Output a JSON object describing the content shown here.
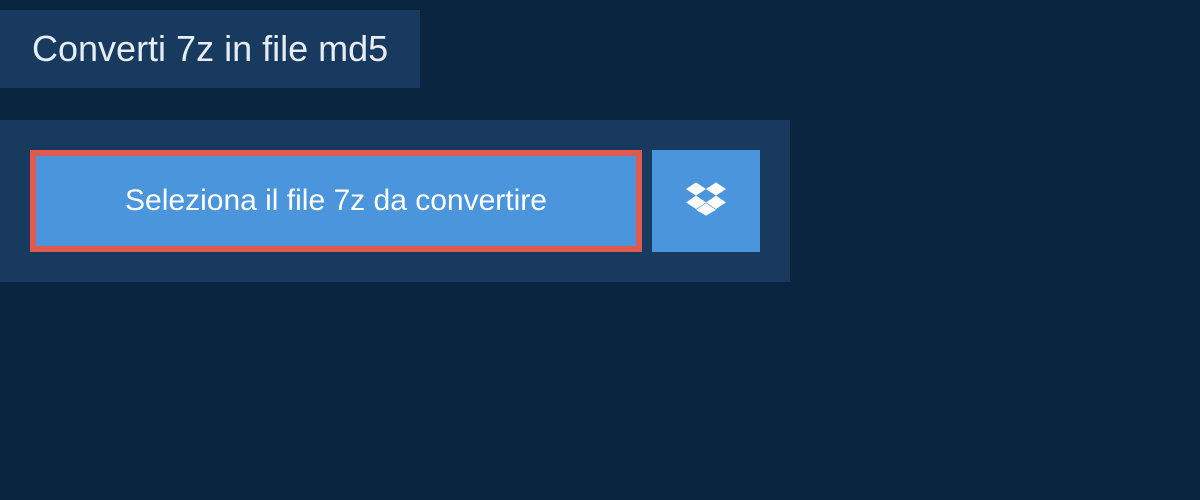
{
  "header": {
    "title": "Converti 7z in file md5"
  },
  "upload": {
    "select_button_label": "Seleziona il file 7z da convertire",
    "dropbox_icon": "dropbox-icon"
  },
  "colors": {
    "background_dark": "#0a2540",
    "panel": "#173a5e",
    "button_primary": "#4b95dd",
    "button_highlight_border": "#e05a4f",
    "text_light": "#e8edf5",
    "text_white": "#ffffff"
  }
}
